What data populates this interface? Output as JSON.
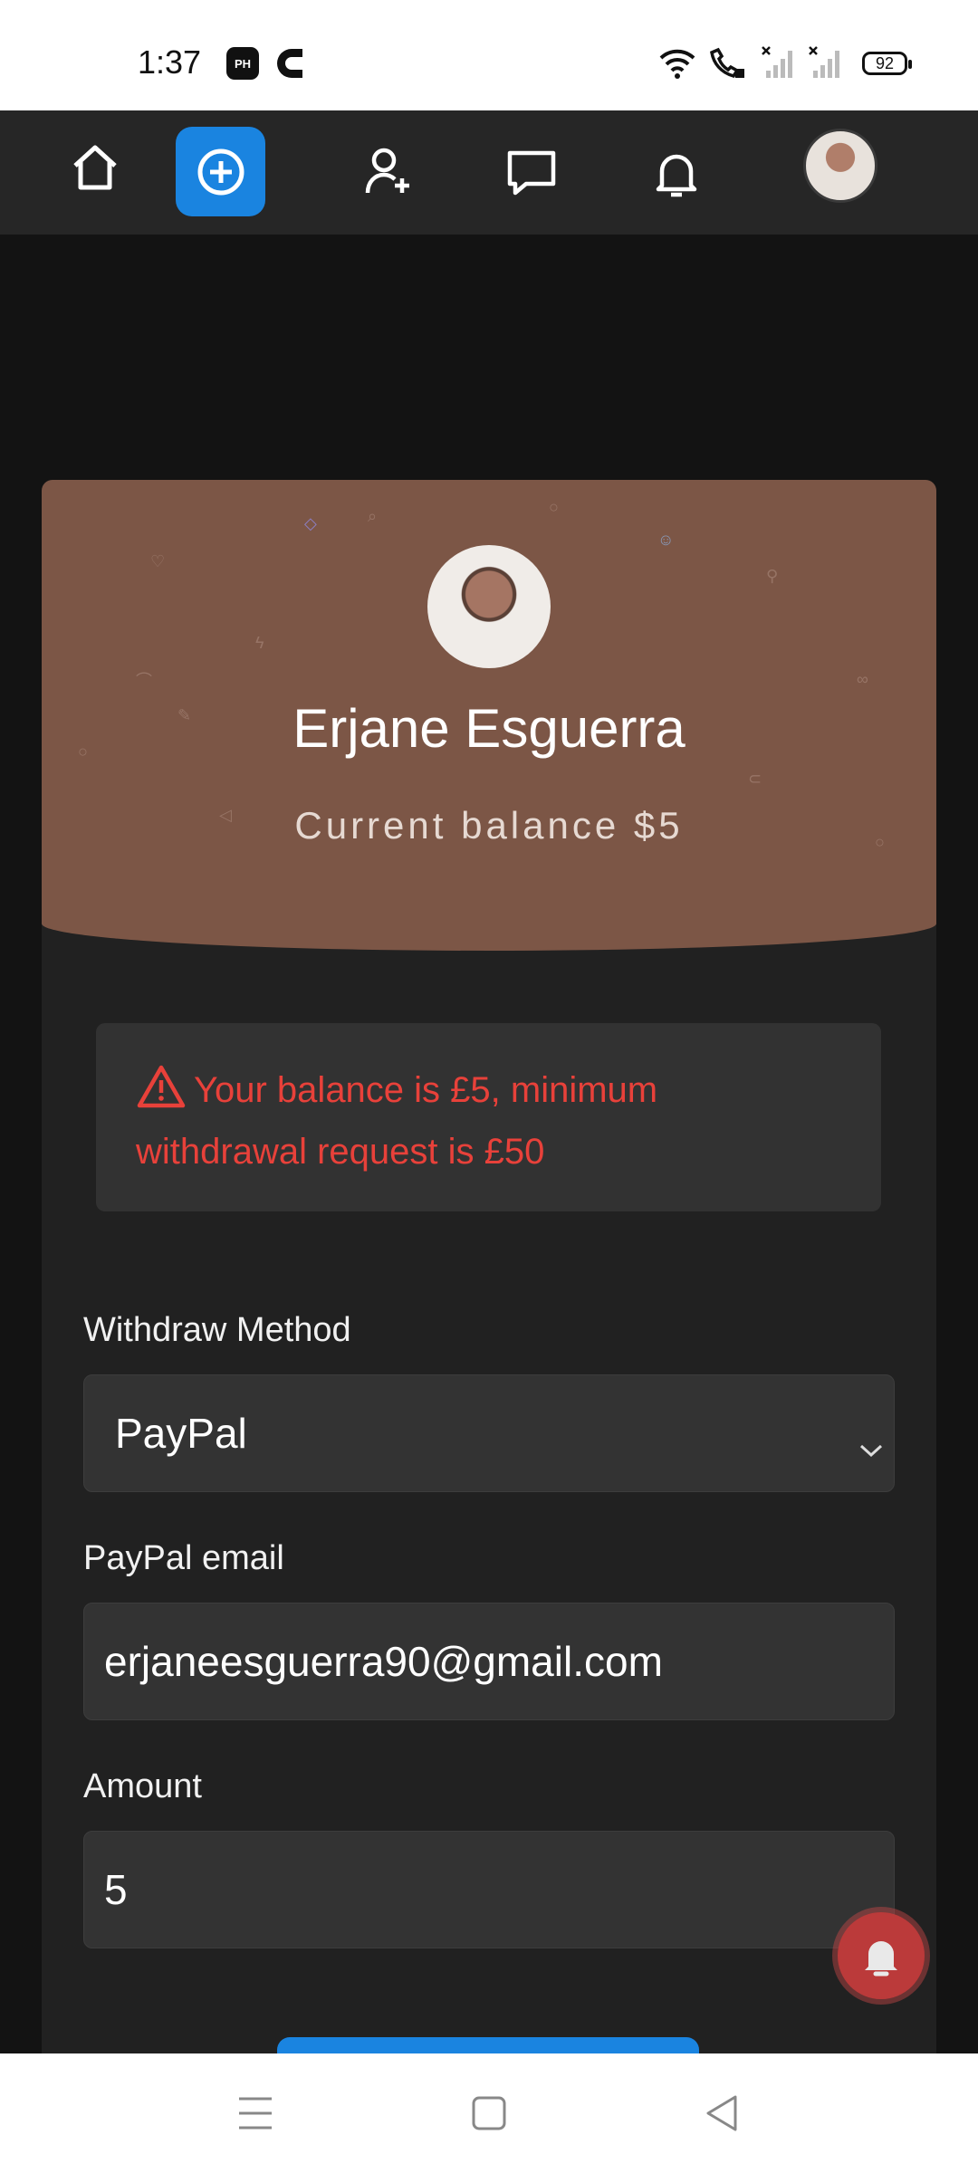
{
  "status_bar": {
    "time": "1:37",
    "app_icon_1": "PH",
    "battery": "92"
  },
  "top_nav": {
    "items": [
      "home-icon",
      "add-circle-icon",
      "add-friend-icon",
      "message-icon",
      "bell-icon",
      "avatar"
    ],
    "accent": "#1a84e0"
  },
  "profile": {
    "name": "Erjane Esguerra",
    "balance_label": "Current  balance  $5",
    "banner_color": "#7c5646"
  },
  "alert": {
    "message_line1": "Your balance is £5, minimum",
    "message_line2": "withdrawal request is £50",
    "color": "#e8413a"
  },
  "form": {
    "method_label": "Withdraw Method",
    "method_value": "PayPal",
    "email_label": "PayPal email",
    "email_value": "erjaneesguerra90@gmail.com",
    "amount_label": "Amount",
    "amount_value": "5"
  }
}
